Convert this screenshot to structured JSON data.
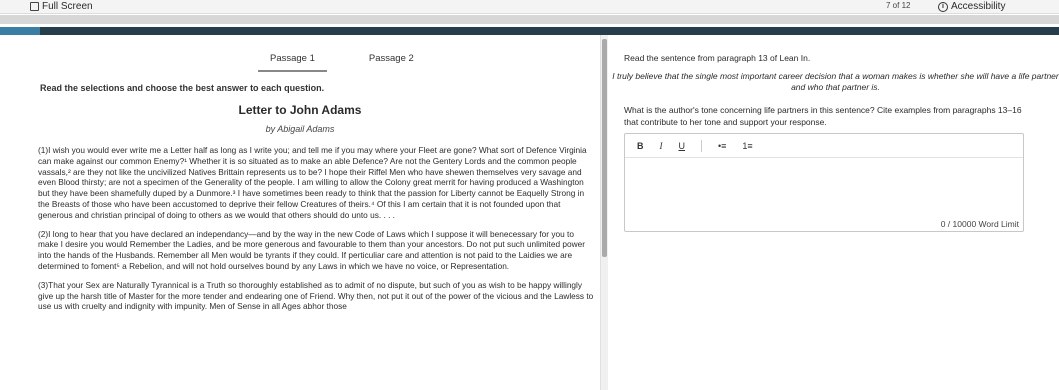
{
  "topbar": {
    "fullscreen_label": "Full Screen",
    "pagination": "7 of 12",
    "accessibility_label": "Accessibility",
    "accessibility_icon_glyph": "i"
  },
  "passage_panel": {
    "tabs": [
      {
        "label": "Passage 1",
        "active": true
      },
      {
        "label": "Passage 2",
        "active": false
      }
    ],
    "instructions": "Read the selections and choose the best answer to each question.",
    "title": "Letter to John Adams",
    "author": "by Abigail Adams",
    "paragraphs": [
      "(1)I wish you would ever write me a Letter half as long as I write you; and tell me if you may where your Fleet are gone? What sort of Defence Virginia can make against our common Enemy?¹ Whether it is so situated as to make an able Defence? Are not the Gentery Lords and the common people vassals,² are they not like the uncivilized Natives Brittain represents us to be? I hope their Riffel Men who have shewen themselves very savage and even Blood thirsty; are not a specimen of the Generality of the people. I am willing to allow the Colony great merrit for having produced a Washington but they have been shamefully duped by a Dunmore.³ I have sometimes been ready to think that the passion for Liberty cannot be Eaquelly Strong in the Breasts of those who have been accustomed to deprive their fellow Creatures of theirs.⁴ Of this I am certain that it is not founded upon that generous and christian principal of doing to others as we would that others should do unto us. . . .",
      "(2)I long to hear that you have declared an independancy—and by the way in the new Code of Laws which I suppose it will benecessary for you to make I desire you would Remember the Ladies, and be more generous and favourable to them than your ancestors. Do not put such unlimited power into the hands of the Husbands. Remember all Men would be tyrants if they could. If perticuliar care and attention is not paid to the Laidies we are determined to foment⁵ a Rebelion, and will not hold ourselves bound by any Laws in which we have no voice, or Representation.",
      "(3)That your Sex are Naturally Tyrannical is a Truth so thoroughly established as to admit of no dispute, but such of you as wish to be happy willingly give up the harsh title of Master for the more tender and endearing one of Friend. Why then, not put it out of the power of the vicious and the Lawless to use us with cruelty and indignity with impunity. Men of Sense in all Ages abhor those"
    ]
  },
  "question_panel": {
    "intro": "Read the sentence from paragraph 13 of Lean In.",
    "quote": "I truly believe that the single most important career decision that a woman makes is whether she will have a life partner and who that partner is.",
    "question": "What is the author's tone concerning life partners in this sentence? Cite examples from paragraphs 13–16 that contribute to her tone and support your response.",
    "editor": {
      "toolbar": {
        "bold": "B",
        "italic": "I",
        "underline": "U",
        "bullet_list": "•≡",
        "numbered_list": "1≡"
      },
      "response_text": "",
      "word_count": "0 / 10000 Word Limit"
    }
  }
}
